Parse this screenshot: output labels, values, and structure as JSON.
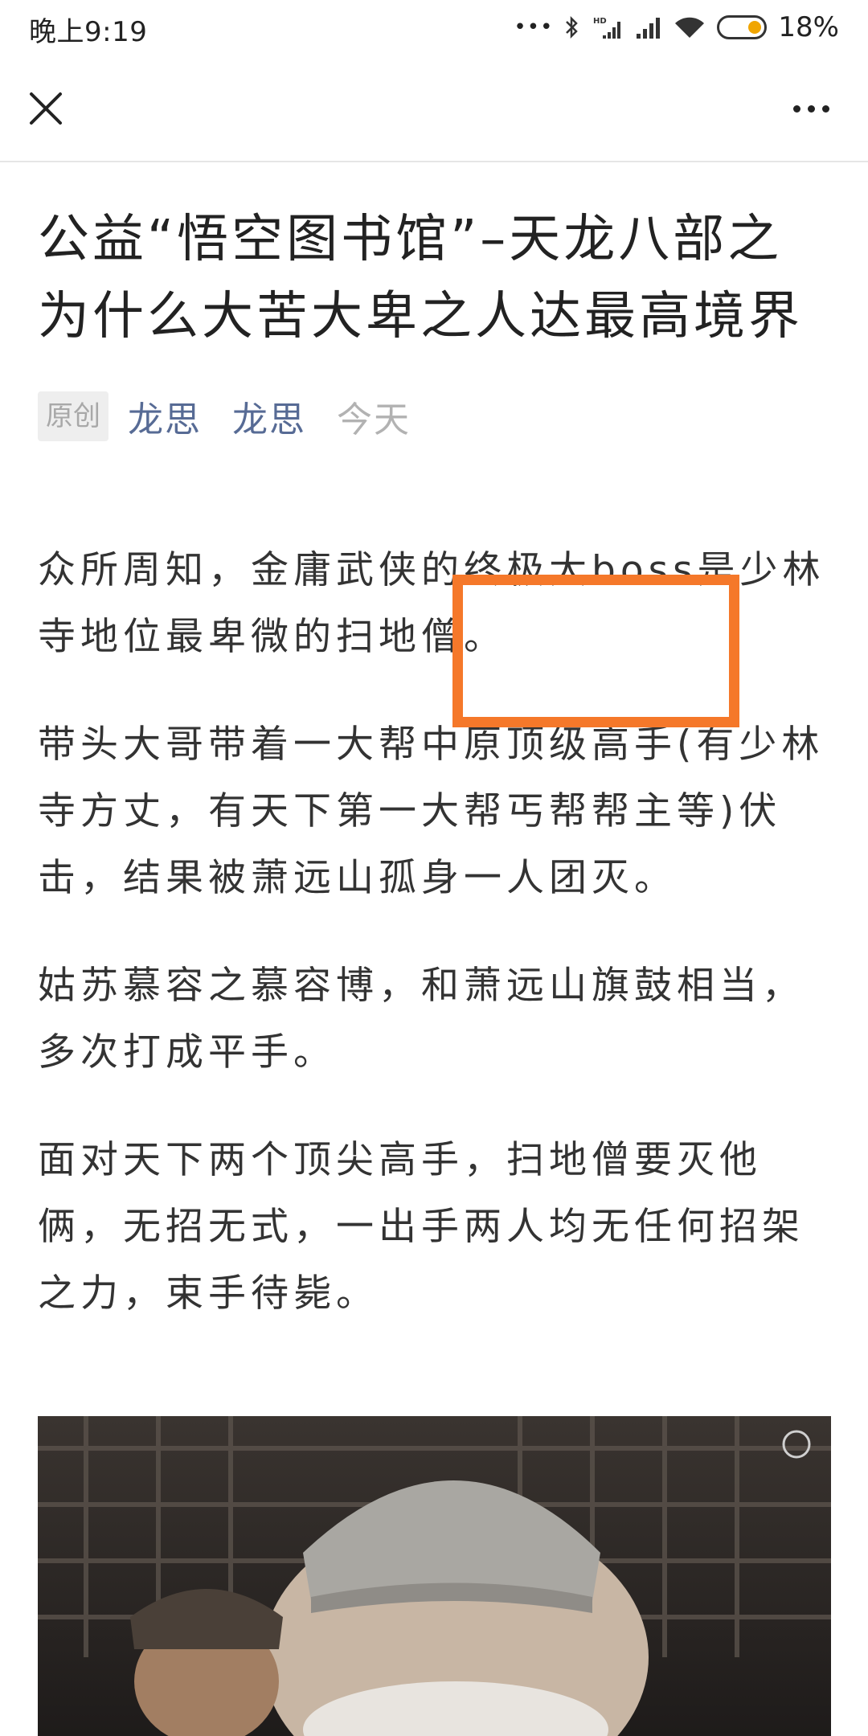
{
  "status_bar": {
    "time": "晚上9:19",
    "dots": "•••",
    "battery_percent": "18%",
    "battery_level": 0.18,
    "battery_color": "#f0a500"
  },
  "nav": {
    "close_icon": "close-icon",
    "more_icon": "more-horizontal-icon"
  },
  "article": {
    "title": "公益“悟空图书馆”–天龙八部之为什么大苦大卑之人达最高境界",
    "badge": "原创",
    "author_1": "龙思",
    "author_2": "龙思",
    "date": "今天",
    "paragraphs": [
      "众所周知，金庸武侠的终极大boss是少林寺地位最卑微的扫地僧。",
      "带头大哥带着一大帮中原顶级高手(有少林寺方丈，有天下第一大帮丐帮帮主等)伏击，结果被萧远山孤身一人团灭。",
      "姑苏慕容之慕容博，和萧远山旗鼓相当，多次打成平手。",
      "面对天下两个顶尖高手，扫地僧要灭他俩，无招无式，一出手两人均无任何招架之力，束手待毙。"
    ],
    "highlight_color": "#f5782a",
    "author_color": "#576b95"
  }
}
